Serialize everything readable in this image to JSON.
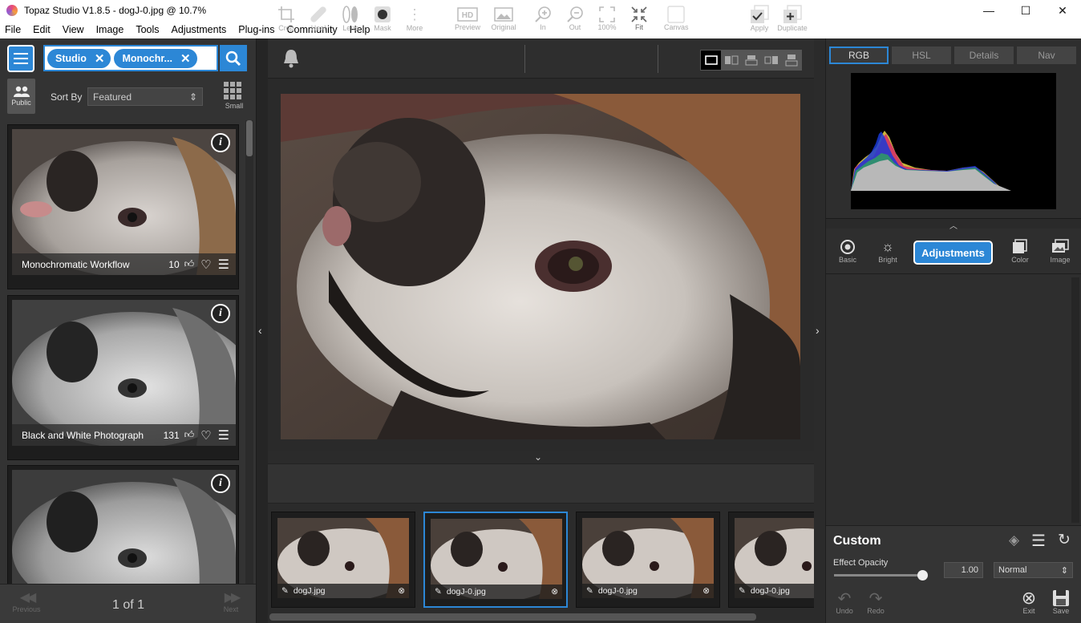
{
  "window": {
    "title": "Topaz Studio V1.8.5 - dogJ-0.jpg @ 10.7%",
    "minimize": "—",
    "maximize": "☐",
    "close": "✕"
  },
  "menu": [
    "File",
    "Edit",
    "View",
    "Image",
    "Tools",
    "Adjustments",
    "Plug-ins",
    "Community",
    "Help"
  ],
  "search": {
    "chips": [
      "Studio",
      "Monochr..."
    ]
  },
  "left": {
    "public_label": "Public",
    "sort_label": "Sort By",
    "sort_value": "Featured",
    "small_label": "Small",
    "cards": [
      {
        "name": "Monochromatic Workflow",
        "likes": "10",
        "style": "color"
      },
      {
        "name": "Black and White Photograph",
        "likes": "131",
        "style": "bw"
      },
      {
        "name": "",
        "likes": "",
        "style": "bw"
      }
    ],
    "pager": {
      "prev": "Previous",
      "next": "Next",
      "page": "1 of 1"
    }
  },
  "toolbar": {
    "preview": "Preview",
    "original": "Original",
    "zoom_in": "In",
    "zoom_out": "Out",
    "zoom_100": "100%",
    "fit": "Fit",
    "canvas": "Canvas"
  },
  "tools": {
    "crop": "Crop",
    "heal": "Heal",
    "lens": "Lens",
    "mask": "Mask",
    "more": "More",
    "apply": "Apply",
    "duplicate": "Duplicate"
  },
  "filmstrip": [
    {
      "name": "dogJ.jpg",
      "selected": false
    },
    {
      "name": "dogJ-0.jpg",
      "selected": true
    },
    {
      "name": "dogJ-0.jpg",
      "selected": false
    },
    {
      "name": "dogJ-0.jpg",
      "selected": false
    }
  ],
  "right": {
    "tabs": [
      "RGB",
      "HSL",
      "Details",
      "Nav"
    ],
    "active_tab": "RGB",
    "categories": {
      "basic": "Basic",
      "bright": "Bright",
      "adjustments": "Adjustments",
      "color": "Color",
      "image": "Image"
    },
    "custom_title": "Custom",
    "effect_opacity_label": "Effect Opacity",
    "effect_opacity_value": "1.00",
    "effect_opacity_fraction": 0.96,
    "blend_mode": "Normal",
    "undo": "Undo",
    "redo": "Redo",
    "exit": "Exit",
    "save": "Save"
  },
  "colors": {
    "accent": "#2c87d6"
  }
}
